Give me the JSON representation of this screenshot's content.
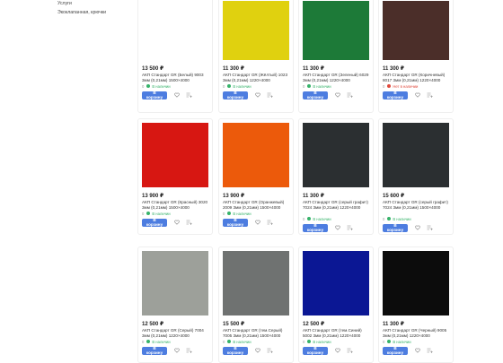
{
  "sidebar": {
    "items": [
      "Услуги",
      "Экоклапанная, крючки"
    ]
  },
  "labels": {
    "add_to_cart": "В корзину"
  },
  "products": [
    {
      "price": "13 500 ₽",
      "title": "АКП Стандарт GR (Белый) 9003 3мм (0,21мм) 1500×4000",
      "count": "0",
      "stock": "В наличии",
      "stock_color": "green",
      "swatch": "#ffffff"
    },
    {
      "price": "11 300 ₽",
      "title": "АКП Стандарт GR (Жёлтый) 1023 3мм (0,21мм) 1220×4000",
      "count": "0",
      "stock": "В наличии",
      "stock_color": "green",
      "swatch": "#e0d10f"
    },
    {
      "price": "11 300 ₽",
      "title": "АКП Стандарт GR (Зеленый) 6029 3мм (0,21мм) 1220×4000",
      "count": "0",
      "stock": "В наличии",
      "stock_color": "green",
      "swatch": "#1d7a38"
    },
    {
      "price": "11 300 ₽",
      "title": "АКП Стандарт GR (Коричневый) 8017 3мм (0,21мм) 1220×4000",
      "count": "0",
      "stock": "Нет в наличии",
      "stock_color": "red",
      "swatch": "#4b2e29"
    },
    {
      "price": "13 900 ₽",
      "title": "АКП Стандарт GR (Красный) 3020 3мм (0,21мм) 1500×4000",
      "count": "0",
      "stock": "В наличии",
      "stock_color": "green",
      "swatch": "#d71712"
    },
    {
      "price": "13 900 ₽",
      "title": "АКП Стандарт GR (Оранжевый) 2009 3мм (0,21мм) 1500×4000",
      "count": "0",
      "stock": "В наличии",
      "stock_color": "green",
      "swatch": "#ec5a0b"
    },
    {
      "price": "11 300 ₽",
      "title": "АКП Стандарт GR (серый графит) 7024 3мм (0,21мм) 1220×4000",
      "count": "0",
      "stock": "В наличии",
      "stock_color": "green",
      "swatch": "#2b2f31"
    },
    {
      "price": "15 600 ₽",
      "title": "АКП Стандарт GR (серый графит) 7024 3мм (0,21мм) 1500×4000",
      "count": "0",
      "stock": "В наличии",
      "stock_color": "green",
      "swatch": "#2b2f31"
    },
    {
      "price": "12 500 ₽",
      "title": "АКП Стандарт GR (Серый) 7004 3мм (0,21мм) 1220×4000",
      "count": "0",
      "stock": "В наличии",
      "stock_color": "green",
      "swatch": "#9da09a"
    },
    {
      "price": "15 500 ₽",
      "title": "АКП Стандарт GR (тем.Серый) 7005 3мм (0,21мм) 1500×4000",
      "count": "0",
      "stock": "В наличии",
      "stock_color": "green",
      "swatch": "#6f7271"
    },
    {
      "price": "12 500 ₽",
      "title": "АКП Стандарт GR (тем.Синий) 5002 3мм (0,21мм) 1220×4000",
      "count": "0",
      "stock": "В наличии",
      "stock_color": "green",
      "swatch": "#0b1794"
    },
    {
      "price": "11 300 ₽",
      "title": "АКП Стандарт GR (Черный) 9005 3мм (0,21мм) 1220×4000",
      "count": "0",
      "stock": "В наличии",
      "stock_color": "green",
      "swatch": "#0c0c0c"
    }
  ]
}
